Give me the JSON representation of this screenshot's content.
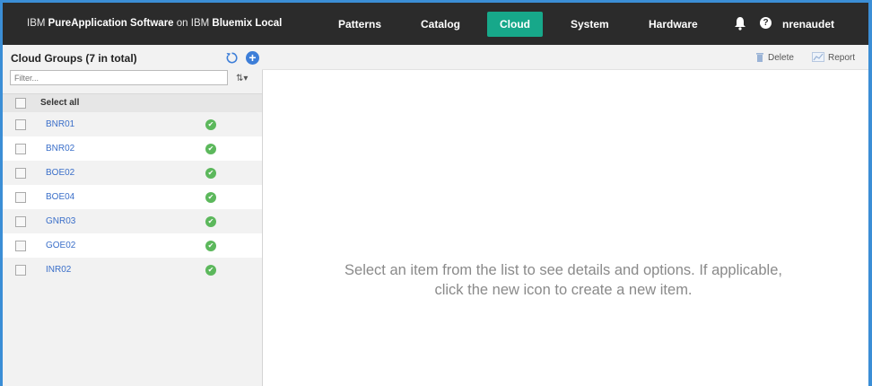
{
  "header": {
    "brand_prefix": "IBM ",
    "brand_bold": "PureApplication Software",
    "brand_mid": " on IBM ",
    "brand_bold2": "Bluemix Local",
    "nav": [
      "Patterns",
      "Catalog",
      "Cloud",
      "System",
      "Hardware"
    ],
    "active_nav": "Cloud",
    "user": "nrenaudet",
    "help_glyph": "?",
    "accent": "#17a88a"
  },
  "left": {
    "title": "Cloud Groups (7 in total)",
    "filter_placeholder": "Filter...",
    "sort_glyph": "⇅▾",
    "new_glyph": "+",
    "select_all": "Select all",
    "items": [
      {
        "name": "BNR01",
        "status": "ok"
      },
      {
        "name": "BNR02",
        "status": "ok"
      },
      {
        "name": "BOE02",
        "status": "ok"
      },
      {
        "name": "BOE04",
        "status": "ok"
      },
      {
        "name": "GNR03",
        "status": "ok"
      },
      {
        "name": "GOE02",
        "status": "ok"
      },
      {
        "name": "INR02",
        "status": "ok"
      }
    ]
  },
  "toolbar": {
    "delete_label": "Delete",
    "report_label": "Report"
  },
  "main": {
    "empty_line1": "Select an item from the list to see details and options. If applicable,",
    "empty_line2": "click the new icon to create a new item."
  }
}
